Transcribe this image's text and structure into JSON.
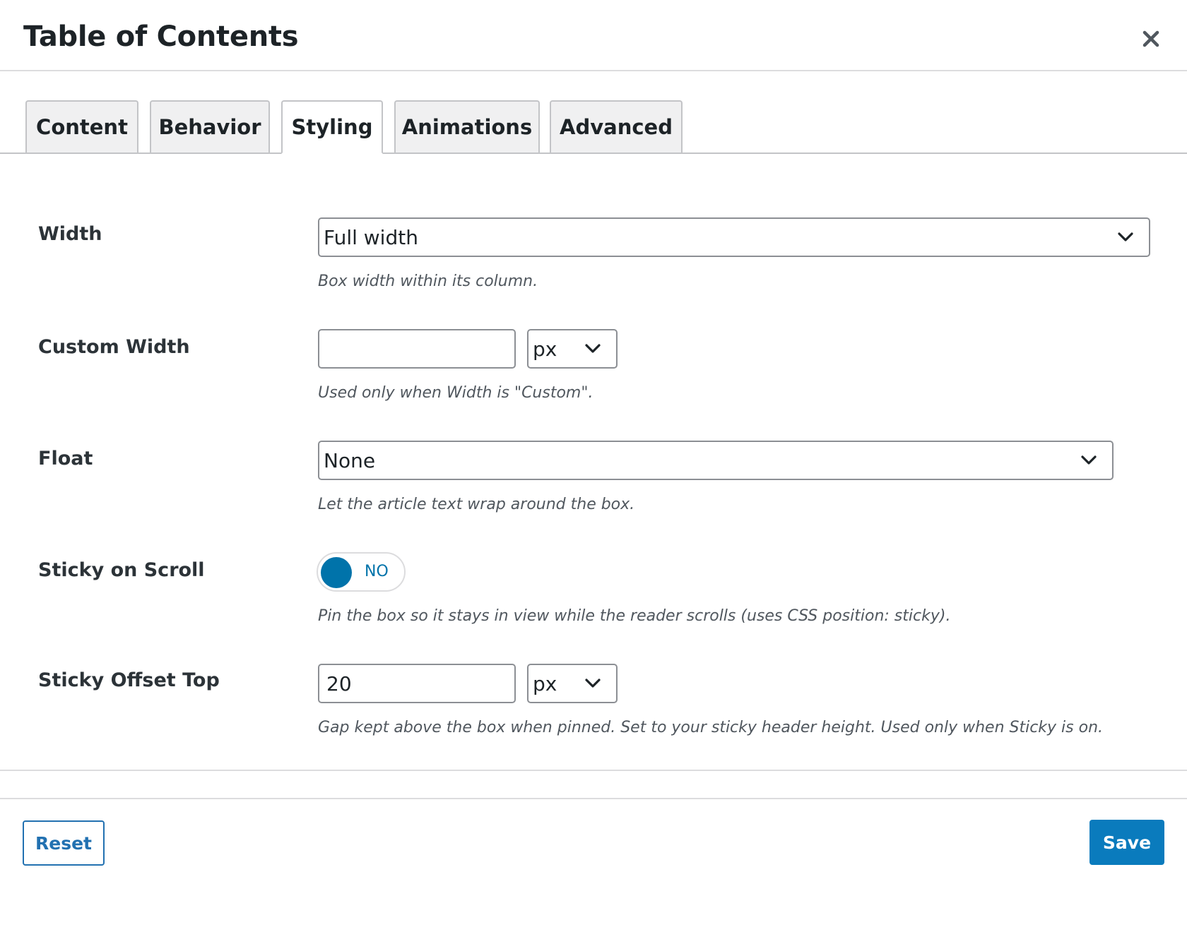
{
  "dialog": {
    "title": "Table of Contents",
    "close_icon": "close-icon"
  },
  "tabs": [
    {
      "label": "Content",
      "active": false
    },
    {
      "label": "Behavior",
      "active": false
    },
    {
      "label": "Styling",
      "active": true
    },
    {
      "label": "Animations",
      "active": false
    },
    {
      "label": "Advanced",
      "active": false
    }
  ],
  "fields": {
    "width": {
      "label": "Width",
      "value": "Full width",
      "description": "Box width within its column."
    },
    "custom_width": {
      "label": "Custom Width",
      "value": "",
      "unit": "px",
      "description": "Used only when Width is \"Custom\"."
    },
    "float": {
      "label": "Float",
      "value": "None",
      "description": "Let the article text wrap around the box."
    },
    "sticky_on_scroll": {
      "label": "Sticky on Scroll",
      "state_text": "NO",
      "enabled": false,
      "description": "Pin the box so it stays in view while the reader scrolls (uses CSS position: sticky)."
    },
    "sticky_offset_top": {
      "label": "Sticky Offset Top",
      "value": "20",
      "unit": "px",
      "description": "Gap kept above the box when pinned. Set to your sticky header height. Used only when Sticky is on."
    }
  },
  "footer": {
    "reset_label": "Reset",
    "save_label": "Save"
  },
  "colors": {
    "accent": "#0073aa",
    "save_button": "#0a7bbd",
    "reset_border": "#2271b1"
  }
}
